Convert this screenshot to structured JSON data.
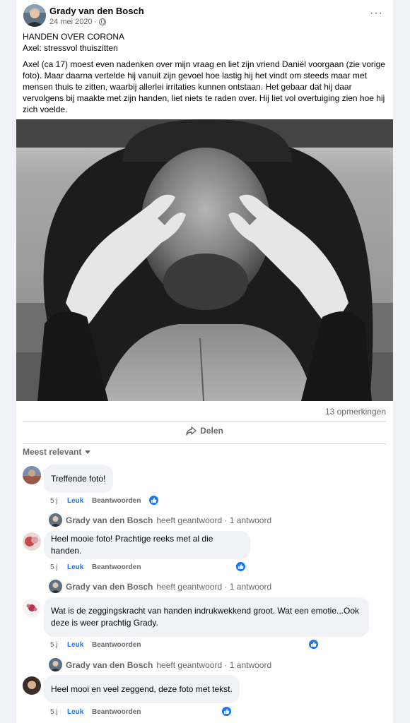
{
  "post": {
    "author": "Grady van den Bosch",
    "date": "24 mei 2020",
    "separator": "·",
    "more_label": "···",
    "title_line": "HANDEN OVER CORONA",
    "subtitle_line": "Axel: stressvol thuiszitten",
    "body": "Axel (ca 17) moest even nadenken over mijn vraag en liet zijn vriend Daniël voorgaan (zie vorige foto). Maar daarna vertelde hij vanuit zijn gevoel hoe lastig hij het vindt om steeds maar met mensen thuis te zitten, waarbij allerlei irritaties kunnen ontstaan. Het gebaar dat hij daar vervolgens bij maakte met zijn handen, liet niets te raden over. Hij liet vol overtuiging zien hoe hij zich voelde."
  },
  "stats": {
    "comments": "13 opmerkingen"
  },
  "share": {
    "label": "Delen"
  },
  "sort": {
    "label": "Meest relevant"
  },
  "comments": [
    {
      "text": "Treffende foto!",
      "time": "5 j",
      "like": "Leuk",
      "reply": "Beantwoorden",
      "reply_author": "Grady van den Bosch",
      "reply_text": "heeft geantwoord · 1 antwoord"
    },
    {
      "text": "Heel mooie foto! Prachtige reeks met al die handen.",
      "time": "5 j",
      "like": "Leuk",
      "reply": "Beantwoorden",
      "reply_author": "Grady van den Bosch",
      "reply_text": "heeft geantwoord · 1 antwoord"
    },
    {
      "text": "Wat is de zeggingskracht van handen indrukwekkend groot. Wat een emotie...Ook deze is weer prachtig Grady.",
      "time": "5 j",
      "like": "Leuk",
      "reply": "Beantwoorden",
      "reply_author": "Grady van den Bosch",
      "reply_text": "heeft geantwoord · 1 antwoord"
    },
    {
      "text": "Heel mooi en veel zeggend, deze foto met tekst.",
      "time": "5 j",
      "like": "Leuk",
      "reply": "Beantwoorden"
    }
  ],
  "colors": {
    "link_blue": "#1877f2",
    "secondary_text": "#65676b",
    "bubble_bg": "#f0f2f5"
  }
}
